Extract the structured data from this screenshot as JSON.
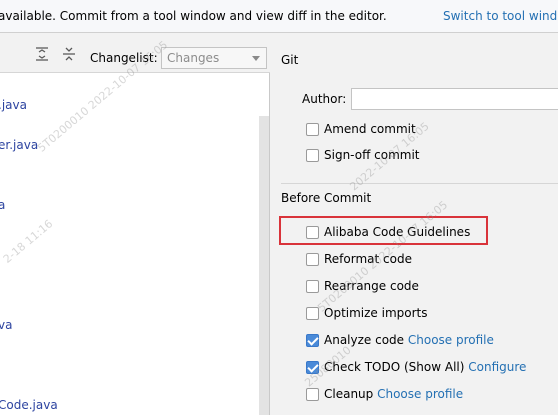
{
  "banner": {
    "text": "available. Commit from a tool window and view diff in the editor.",
    "link": "Switch to tool wind"
  },
  "left_panel": {
    "changelist_label": "Changelist:",
    "changelist_value": "Changes",
    "files": [
      ".java",
      "er.java",
      "a",
      "va",
      "Code.java"
    ]
  },
  "right_panel": {
    "git_title": "Git",
    "author_label": "Author:",
    "author_value": "",
    "options_git": [
      {
        "label": "Amend commit",
        "checked": false
      },
      {
        "label": "Sign-off commit",
        "checked": false
      }
    ],
    "before_commit_title": "Before Commit",
    "before_commit": [
      {
        "label": "Alibaba Code Guidelines",
        "checked": false,
        "link": ""
      },
      {
        "label": "Reformat code",
        "checked": false,
        "link": ""
      },
      {
        "label": "Rearrange code",
        "checked": false,
        "link": ""
      },
      {
        "label": "Optimize imports",
        "checked": false,
        "link": ""
      },
      {
        "label": "Analyze code",
        "checked": true,
        "link": "Choose profile"
      },
      {
        "label": "Check TODO (Show All)",
        "checked": true,
        "link": "Configure"
      },
      {
        "label": "Cleanup",
        "checked": false,
        "link": "Choose profile"
      }
    ]
  },
  "watermark": {
    "line1": "5T0200010 2022-10-07 16:05",
    "line2": "2022-10-07 16:05",
    "line3": "5T0200010 2022-10-07 16:05",
    "line4": "2-18 11:16",
    "line5": "25080010"
  }
}
